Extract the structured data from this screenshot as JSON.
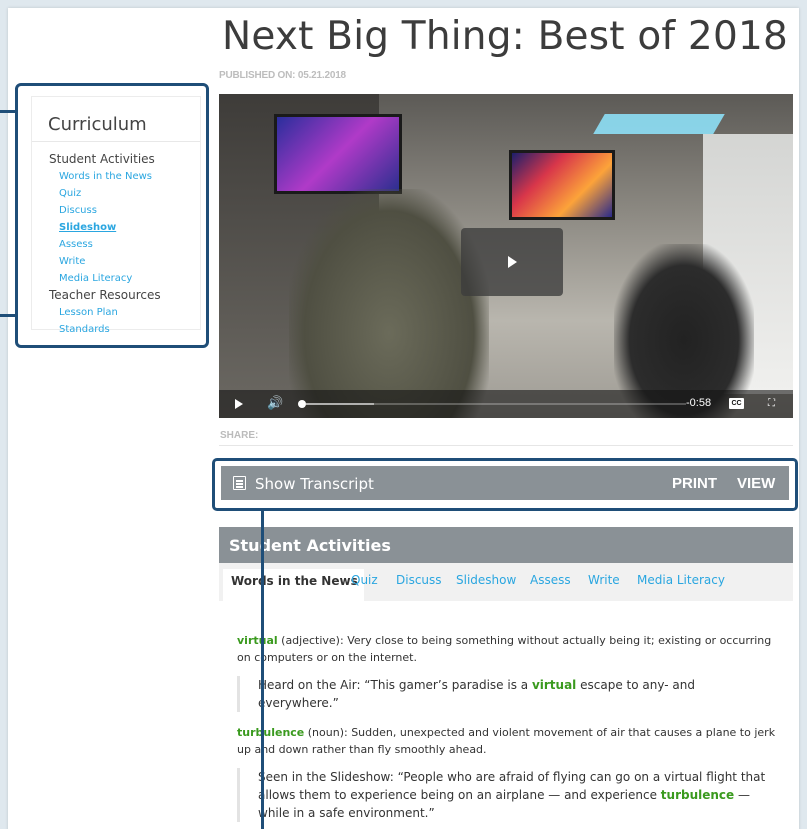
{
  "article": {
    "title": "Next Big Thing: Best of 2018",
    "published": "PUBLISHED ON: 05.21.2018",
    "share_label": "SHARE:"
  },
  "sidebar": {
    "title": "Curriculum",
    "sections": [
      {
        "heading": "Student Activities",
        "items": [
          {
            "label": "Words in the News",
            "active": false
          },
          {
            "label": "Quiz",
            "active": false
          },
          {
            "label": "Discuss",
            "active": false
          },
          {
            "label": "Slideshow",
            "active": true
          },
          {
            "label": "Assess",
            "active": false
          },
          {
            "label": "Write",
            "active": false
          },
          {
            "label": "Media Literacy",
            "active": false
          }
        ]
      },
      {
        "heading": "Teacher Resources",
        "items": [
          {
            "label": "Lesson Plan",
            "active": false
          },
          {
            "label": "Standards",
            "active": false
          }
        ]
      }
    ]
  },
  "video": {
    "time_remaining": "-0:58",
    "cc_label": "CC",
    "progress": 0.0
  },
  "transcript_bar": {
    "show_label": "Show Transcript",
    "print_label": "PRINT",
    "view_label": "VIEW",
    "icon": "list-icon"
  },
  "activities": {
    "title": "Student Activities",
    "tabs": [
      {
        "label": "Words in the News",
        "active": true
      },
      {
        "label": "Quiz",
        "active": false
      },
      {
        "label": "Discuss",
        "active": false
      },
      {
        "label": "Slideshow",
        "active": false
      },
      {
        "label": "Assess",
        "active": false
      },
      {
        "label": "Write",
        "active": false
      },
      {
        "label": "Media Literacy",
        "active": false
      }
    ],
    "words": [
      {
        "term": "virtual",
        "pos": " (adjective): ",
        "definition": "Very close to being something without actually being it; existing or occurring on computers or on the internet.",
        "quote_pre": "Heard on the Air: “This gamer’s paradise is a ",
        "quote_term": "virtual",
        "quote_post": " escape to any- and everywhere.”"
      },
      {
        "term": "turbulence",
        "pos": " (noun): ",
        "definition": "Sudden, unexpected and violent movement of air that causes a plane to jerk up and down rather than fly smoothly ahead.",
        "quote_pre": "Seen in the Slideshow: “People who are afraid of flying can go on a virtual flight that allows them to experience being on an airplane — and experience ",
        "quote_term": "turbulence",
        "quote_post": " — while in a safe environment.”"
      }
    ]
  },
  "colors": {
    "link": "#2aa6e0",
    "term": "#3a9a1e",
    "callout": "#1f4e78",
    "bar": "#8a9196"
  }
}
